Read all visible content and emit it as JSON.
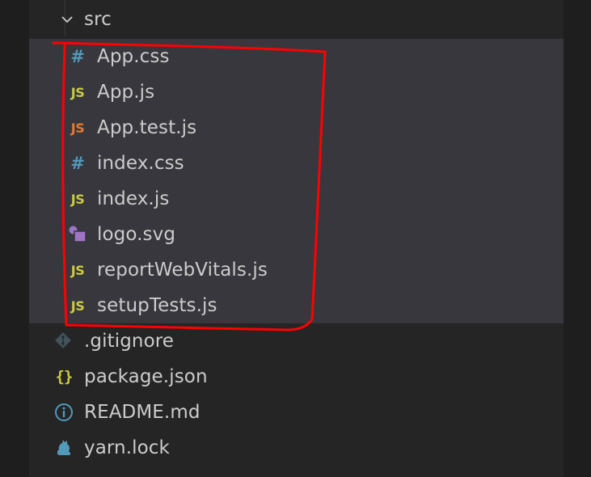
{
  "explorer": {
    "folder": {
      "name": "src",
      "expanded": true,
      "files": [
        {
          "name": "App.css",
          "icon": "css-hash-icon",
          "icon_text": "#",
          "icon_color": "#519aba"
        },
        {
          "name": "App.js",
          "icon": "js-icon",
          "icon_text": "JS",
          "icon_color": "#cbcb41"
        },
        {
          "name": "App.test.js",
          "icon": "js-test-icon",
          "icon_text": "JS",
          "icon_color": "#e37933"
        },
        {
          "name": "index.css",
          "icon": "css-hash-icon",
          "icon_text": "#",
          "icon_color": "#519aba"
        },
        {
          "name": "index.js",
          "icon": "js-icon",
          "icon_text": "JS",
          "icon_color": "#cbcb41"
        },
        {
          "name": "logo.svg",
          "icon": "svg-image-icon",
          "icon_text": "",
          "icon_color": "#a074c4"
        },
        {
          "name": "reportWebVitals.js",
          "icon": "js-icon",
          "icon_text": "JS",
          "icon_color": "#cbcb41"
        },
        {
          "name": "setupTests.js",
          "icon": "js-icon",
          "icon_text": "JS",
          "icon_color": "#cbcb41"
        }
      ]
    },
    "root_files": [
      {
        "name": ".gitignore",
        "icon": "git-diamond-icon",
        "icon_color": "#41535b"
      },
      {
        "name": "package.json",
        "icon": "json-braces-icon",
        "icon_text": "{}",
        "icon_color": "#cbcb41"
      },
      {
        "name": "README.md",
        "icon": "info-icon",
        "icon_text": "i",
        "icon_color": "#519aba"
      },
      {
        "name": "yarn.lock",
        "icon": "yarn-cat-icon",
        "icon_color": "#519aba"
      }
    ]
  },
  "colors": {
    "background": "#252526",
    "selected_group": "#37373d",
    "text": "#cccccc",
    "annotation": "#ff0000"
  }
}
